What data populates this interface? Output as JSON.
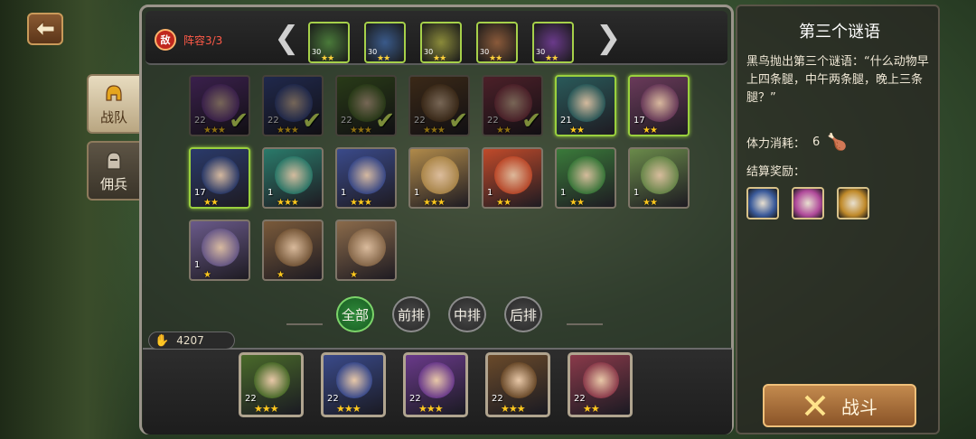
{
  "sidebar": {
    "back_icon": "back-arrow-icon",
    "tabs": [
      {
        "label": "战队",
        "icon": "helmet-icon",
        "active": true
      },
      {
        "label": "佣兵",
        "icon": "knight-helmet-icon",
        "active": false
      }
    ]
  },
  "enemy": {
    "badge": "敌",
    "lineup_label": "阵容3/3",
    "prev_arrow": "❮",
    "next_arrow": "❯",
    "heroes": [
      {
        "level": "30",
        "stars": "★★",
        "color": "#4a7a3a"
      },
      {
        "level": "30",
        "stars": "★★",
        "color": "#3a5a8a"
      },
      {
        "level": "30",
        "stars": "★★",
        "color": "#8a8a3a"
      },
      {
        "level": "30",
        "stars": "★★",
        "color": "#8a5a3a"
      },
      {
        "level": "30",
        "stars": "★★",
        "color": "#6a3a8a"
      }
    ]
  },
  "roster": [
    {
      "level": "22",
      "stars": "★★★",
      "check": "✔",
      "selected": false,
      "dim": true,
      "color": "#6a3a8a"
    },
    {
      "level": "22",
      "stars": "★★★",
      "check": "✔",
      "selected": false,
      "dim": true,
      "color": "#3a4a8a"
    },
    {
      "level": "22",
      "stars": "★★★",
      "check": "✔",
      "selected": false,
      "dim": true,
      "color": "#4a6a2a"
    },
    {
      "level": "22",
      "stars": "★★★",
      "check": "✔",
      "selected": false,
      "dim": true,
      "color": "#6a4a2a"
    },
    {
      "level": "22",
      "stars": "★★",
      "check": "✔",
      "selected": false,
      "dim": true,
      "color": "#8a3a4a"
    },
    {
      "level": "21",
      "stars": "★★",
      "check": "",
      "selected": true,
      "dim": false,
      "color": "#2a5a5a"
    },
    {
      "level": "17",
      "stars": "★★",
      "check": "",
      "selected": true,
      "dim": false,
      "color": "#6a3a5a"
    },
    {
      "level": "17",
      "stars": "★★",
      "check": "",
      "selected": true,
      "dim": false,
      "color": "#2a3a6a"
    },
    {
      "level": "1",
      "stars": "★★★",
      "check": "",
      "selected": false,
      "dim": false,
      "color": "#2a7a6a"
    },
    {
      "level": "1",
      "stars": "★★★",
      "check": "",
      "selected": false,
      "dim": false,
      "color": "#3a4a8a"
    },
    {
      "level": "1",
      "stars": "★★★",
      "check": "",
      "selected": false,
      "dim": false,
      "color": "#b08a4a"
    },
    {
      "level": "1",
      "stars": "★★",
      "check": "",
      "selected": false,
      "dim": false,
      "color": "#c04a2a"
    },
    {
      "level": "1",
      "stars": "★★",
      "check": "",
      "selected": false,
      "dim": false,
      "color": "#3a7a3a"
    },
    {
      "level": "1",
      "stars": "★★",
      "check": "",
      "selected": false,
      "dim": false,
      "color": "#6a8a4a"
    },
    {
      "level": "1",
      "stars": "★",
      "check": "",
      "selected": false,
      "dim": false,
      "color": "#6a5a8a"
    },
    {
      "level": "",
      "stars": "★",
      "check": "",
      "selected": false,
      "dim": false,
      "color": "#7a5a3a"
    },
    {
      "level": "",
      "stars": "★",
      "check": "",
      "selected": false,
      "dim": false,
      "color": "#8a6a4a"
    }
  ],
  "filters": [
    {
      "label": "全部",
      "active": true
    },
    {
      "label": "前排",
      "active": false
    },
    {
      "label": "中排",
      "active": false
    },
    {
      "label": "后排",
      "active": false
    }
  ],
  "power": {
    "icon": "paw-icon",
    "value": "4207"
  },
  "team": [
    {
      "level": "22",
      "stars": "★★★",
      "color": "#4a6a2a"
    },
    {
      "level": "22",
      "stars": "★★★",
      "color": "#3a4a8a"
    },
    {
      "level": "22",
      "stars": "★★★",
      "color": "#6a3a8a"
    },
    {
      "level": "22",
      "stars": "★★★",
      "color": "#6a4a2a"
    },
    {
      "level": "22",
      "stars": "★★",
      "color": "#8a3a4a"
    }
  ],
  "riddle": {
    "title": "第三个谜语",
    "text": "黑鸟抛出第三个谜语：“什么动物早上四条腿，中午两条腿，晚上三条腿？”",
    "stamina_label": "体力消耗：",
    "stamina_value": "6",
    "reward_label": "结算奖励：",
    "rewards": [
      {
        "icon": "hammer-icon",
        "color": "#3a5a9a"
      },
      {
        "icon": "scroll-icon",
        "color": "#b04a9a"
      },
      {
        "icon": "axe-icon",
        "color": "#c08a2a"
      }
    ],
    "fight_label": "战斗"
  }
}
